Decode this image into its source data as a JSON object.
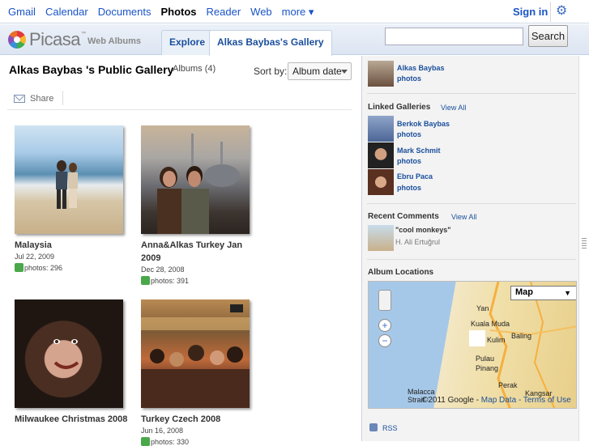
{
  "gbar": {
    "items": [
      "Gmail",
      "Calendar",
      "Documents",
      "Photos",
      "Reader",
      "Web",
      "more ▾"
    ],
    "active_index": 3,
    "signin": "Sign in",
    "settings_icon": "gear-icon"
  },
  "header": {
    "logo_name": "Picasa",
    "logo_tm": "™",
    "logo_sub": "Web Albums",
    "tabs": [
      {
        "label": "Explore",
        "active": false
      },
      {
        "label": "Alkas Baybas's Gallery",
        "active": true
      }
    ],
    "search_value": "",
    "search_button": "Search"
  },
  "main": {
    "title": "Alkas Baybas 's Public Gallery",
    "albums_count": "Albums (4)",
    "sort_label": "Sort by:",
    "sort_value": "Album date",
    "share_label": "Share",
    "albums": [
      {
        "title": "Malaysia",
        "date": "Jul 22, 2009",
        "photos": "photos: 296"
      },
      {
        "title": "Anna&Alkas Turkey Jan 2009",
        "date": "Dec 28, 2008",
        "photos": "photos: 391"
      },
      {
        "title": "Milwaukee Christmas 2008",
        "date": "",
        "photos": ""
      },
      {
        "title": "Turkey Czech 2008",
        "date": "Jun 16, 2008",
        "photos": "photos: 330"
      }
    ]
  },
  "sidebar": {
    "owner": {
      "name": "Alkas Baybas",
      "photos": "photos"
    },
    "linked_heading": "Linked Galleries",
    "linked_view_all": "View All",
    "linked": [
      {
        "name": "Berkok Baybas",
        "photos": "photos"
      },
      {
        "name": "Mark Schmit",
        "photos": "photos"
      },
      {
        "name": "Ebru Paca",
        "photos": "photos"
      }
    ],
    "comments_heading": "Recent Comments",
    "comments_view_all": "View All",
    "comment": {
      "text": "\"cool monkeys\"",
      "author": "H. Ali Ertuğrul"
    },
    "locations_heading": "Album Locations",
    "map": {
      "type_label": "Map",
      "places": [
        "Yan",
        "Kuala Muda",
        "Kulim",
        "Baling",
        "Pulau Pinang",
        "Perak",
        "Kangsar",
        "Malacca Strait"
      ],
      "copyright": "©2011 Google -",
      "map_data": "Map Data",
      "terms": "- Terms of Use"
    },
    "rss": "RSS"
  }
}
